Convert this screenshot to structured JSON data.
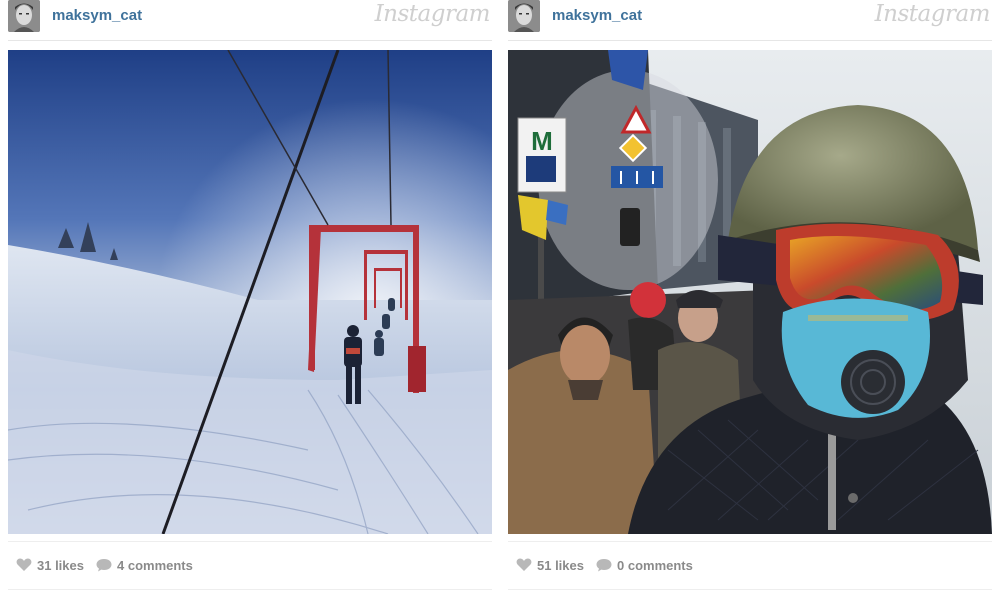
{
  "posts": [
    {
      "username": "maksym_cat",
      "brand": "Instagram",
      "likes": "31 likes",
      "comments": "4 comments",
      "photo_subject": "ski-lift-slope"
    },
    {
      "username": "maksym_cat",
      "brand": "Instagram",
      "likes": "51 likes",
      "comments": "0 comments",
      "photo_subject": "protester-helmet-goggles",
      "sign_text": "M"
    }
  ],
  "icons": {
    "like": "heart-icon",
    "comment": "speech-bubble-icon"
  },
  "colors": {
    "username": "#3f729b",
    "stat_text": "#8a8a8a",
    "brand": "#cfcfcf"
  }
}
